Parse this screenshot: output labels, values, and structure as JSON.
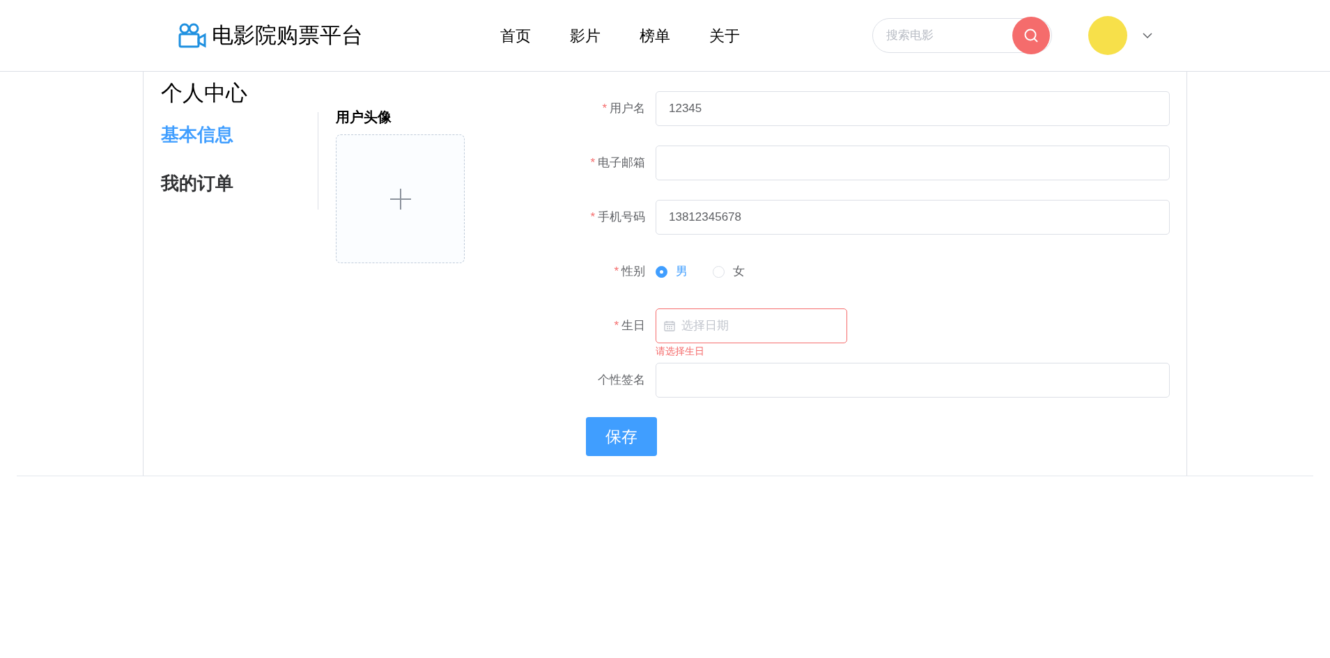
{
  "header": {
    "logo_text": "电影院购票平台",
    "nav": [
      {
        "label": "首页"
      },
      {
        "label": "影片"
      },
      {
        "label": "榜单"
      },
      {
        "label": "关于"
      }
    ],
    "search": {
      "placeholder": "搜索电影"
    }
  },
  "sidebar": {
    "title": "个人中心",
    "items": [
      {
        "label": "基本信息",
        "selected": true
      },
      {
        "label": "我的订单",
        "selected": false
      }
    ]
  },
  "avatar_upload": {
    "title": "用户头像"
  },
  "form": {
    "required_mark": "*",
    "fields": [
      {
        "kind": "text",
        "label": "用户名",
        "required": true,
        "value": "12345"
      },
      {
        "kind": "text",
        "label": "电子邮箱",
        "required": true
      },
      {
        "kind": "text",
        "label": "手机号码",
        "required": true,
        "value": "13812345678"
      },
      {
        "kind": "radio",
        "label": "性别",
        "required": true,
        "options": [
          {
            "label": "男",
            "selected": true
          },
          {
            "label": "女",
            "selected": false
          }
        ]
      },
      {
        "kind": "date",
        "label": "生日",
        "required": true,
        "placeholder": "选择日期",
        "error": "请选择生日"
      },
      {
        "kind": "text",
        "label": "个性签名",
        "required": false
      }
    ],
    "submit": "保存"
  }
}
